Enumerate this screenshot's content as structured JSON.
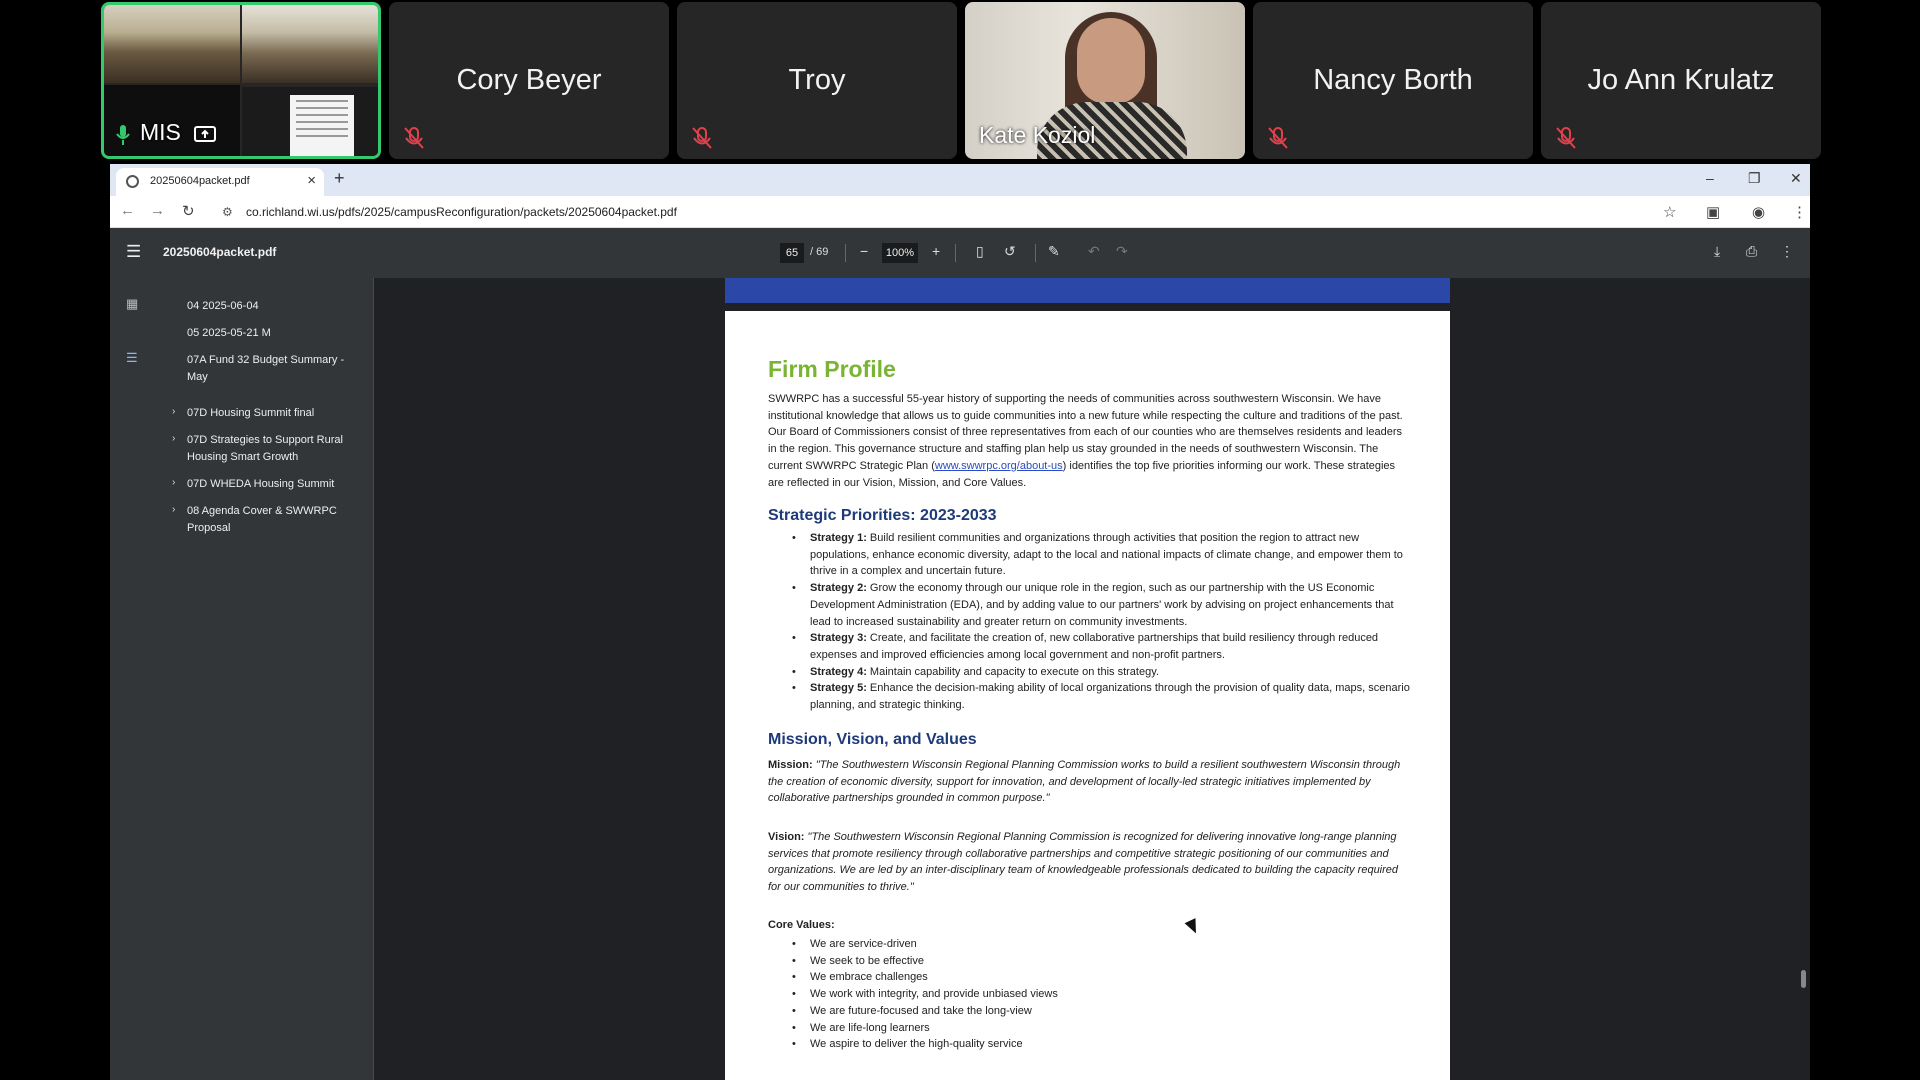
{
  "participants": [
    {
      "name": "MIS",
      "type": "video",
      "active": true
    },
    {
      "name": "Cory Beyer",
      "type": "avatar",
      "muted": true
    },
    {
      "name": "Troy",
      "type": "avatar",
      "muted": true
    },
    {
      "name": "Kate Koziol",
      "type": "video"
    },
    {
      "name": "Nancy Borth",
      "type": "avatar",
      "muted": true
    },
    {
      "name": "Jo Ann Krulatz",
      "type": "avatar",
      "muted": true
    }
  ],
  "browser": {
    "tab_title": "20250604packet.pdf",
    "url": "co.richland.wi.us/pdfs/2025/campusReconfiguration/packets/20250604packet.pdf"
  },
  "pdf": {
    "filename": "20250604packet.pdf",
    "page_current": "65",
    "page_total": "/ 69",
    "zoom": "100%",
    "bookmarks": [
      {
        "label": "04 2025-06-04",
        "expandable": false
      },
      {
        "label": "05 2025-05-21 M",
        "expandable": false
      },
      {
        "label": "07A Fund 32 Budget Summary - May",
        "expandable": false
      },
      {
        "label": "07D Housing Summit final",
        "expandable": true
      },
      {
        "label": "07D Strategies to Support Rural Housing Smart Growth",
        "expandable": true
      },
      {
        "label": "07D WHEDA Housing Summit",
        "expandable": true
      },
      {
        "label": "08 Agenda Cover & SWWRPC Proposal",
        "expandable": true
      }
    ]
  },
  "document": {
    "title": "Firm Profile",
    "intro_before_link": "SWWRPC has a successful 55-year history of supporting the needs of communities across southwestern Wisconsin. We have institutional knowledge that allows us to guide communities into a new future while respecting the culture and traditions of the past. Our Board of Commissioners consist of three representatives from each of our counties who are themselves residents and leaders in the region. This governance structure and staffing plan help us stay grounded in the needs of southwestern Wisconsin. The current SWWRPC Strategic Plan (",
    "intro_link": "www.swwrpc.org/about-us",
    "intro_after_link": ") identifies the top five priorities informing our work. These strategies are reflected in our Vision, Mission, and Core Values.",
    "priorities_heading": "Strategic Priorities: 2023-2033",
    "strategies": [
      {
        "label": "Strategy 1:",
        "text": "Build resilient communities and organizations through activities that position the region to attract new populations, enhance economic diversity, adapt to the local and national impacts of climate change, and empower them to thrive in a complex and uncertain future."
      },
      {
        "label": "Strategy 2:",
        "text": "Grow the economy through our unique role in the region, such as our partnership with the US Economic Development Administration (EDA), and by adding value to our partners' work by advising on project enhancements that lead to increased sustainability and greater return on community investments."
      },
      {
        "label": "Strategy 3:",
        "text": "Create, and facilitate the creation of, new collaborative partnerships that build resiliency through reduced expenses and improved efficiencies among local government and non-profit partners."
      },
      {
        "label": "Strategy 4:",
        "text": "Maintain capability and capacity to execute on this strategy."
      },
      {
        "label": "Strategy 5:",
        "text": "Enhance the decision-making ability of local organizations through the provision of quality data, maps, scenario planning, and strategic thinking."
      }
    ],
    "mvv_heading": "Mission, Vision, and Values",
    "mission_label": "Mission:",
    "mission_text": "\"The Southwestern Wisconsin Regional Planning Commission works to build a resilient southwestern Wisconsin through the creation of economic diversity, support for innovation, and development of locally-led strategic initiatives implemented by collaborative partnerships grounded in common purpose.\"",
    "vision_label": "Vision:",
    "vision_text": "\"The Southwestern Wisconsin Regional Planning Commission is recognized for delivering innovative long-range planning services that promote resiliency through collaborative partnerships and competitive strategic positioning of our communities and organizations. We are led by an inter-disciplinary team of knowledgeable professionals dedicated to building the capacity required for our communities to thrive.\"",
    "core_values_label": "Core Values:",
    "core_values": [
      "We are service-driven",
      "We seek to be effective",
      "We embrace challenges",
      "We work with integrity, and provide unbiased views",
      "We are future-focused and take the long-view",
      "We are life-long learners",
      "We aspire to deliver the high-quality service"
    ]
  },
  "colors": {
    "active_speaker_border": "#35c96e",
    "doc_title": "#7ab434",
    "doc_heading": "#1f3a78",
    "page_header_band": "#2b47a8"
  }
}
